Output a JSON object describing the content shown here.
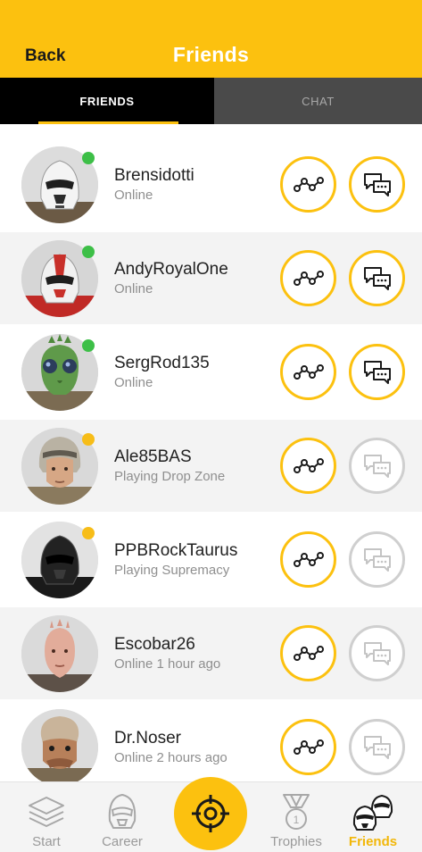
{
  "header": {
    "back_label": "Back",
    "title": "Friends"
  },
  "tabs": [
    {
      "label": "FRIENDS",
      "active": true
    },
    {
      "label": "CHAT",
      "active": false
    }
  ],
  "friends": [
    {
      "name": "Brensidotti",
      "status": "Online",
      "state": "online",
      "chat_enabled": true,
      "avatar": "stormtrooper-portrait"
    },
    {
      "name": "AndyRoyalOne",
      "status": "Online",
      "state": "online",
      "chat_enabled": true,
      "avatar": "red-shock-trooper-portrait"
    },
    {
      "name": "SergRod135",
      "status": "Online",
      "state": "online",
      "chat_enabled": true,
      "avatar": "rodian-portrait"
    },
    {
      "name": "Ale85BAS",
      "status": "Playing Drop Zone",
      "state": "playing",
      "chat_enabled": false,
      "avatar": "pilot-portrait"
    },
    {
      "name": "PPBRockTaurus",
      "status": "Playing Supremacy",
      "state": "playing",
      "chat_enabled": false,
      "avatar": "shadow-trooper-portrait"
    },
    {
      "name": "Escobar26",
      "status": "Online 1 hour ago",
      "state": "away",
      "chat_enabled": false,
      "avatar": "zabrak-portrait"
    },
    {
      "name": "Dr.Noser",
      "status": "Online 2 hours ago",
      "state": "away",
      "chat_enabled": false,
      "avatar": "nien-nunb-portrait"
    }
  ],
  "nav": {
    "items": [
      {
        "label": "Start",
        "icon": "layers-icon",
        "active": false
      },
      {
        "label": "Career",
        "icon": "trooper-helmet-icon",
        "active": false
      },
      {
        "label": "Trophies",
        "icon": "trophy-medal-icon",
        "active": false
      },
      {
        "label": "Friends",
        "icon": "friends-helmets-icon",
        "active": true
      }
    ],
    "center_icon": "target-crosshair-icon"
  },
  "colors": {
    "accent": "#fcc10f",
    "online": "#3dbf47",
    "playing": "#f7bd18",
    "tab_active_bg": "#000000",
    "tab_inactive_bg": "#4a4a4a"
  }
}
